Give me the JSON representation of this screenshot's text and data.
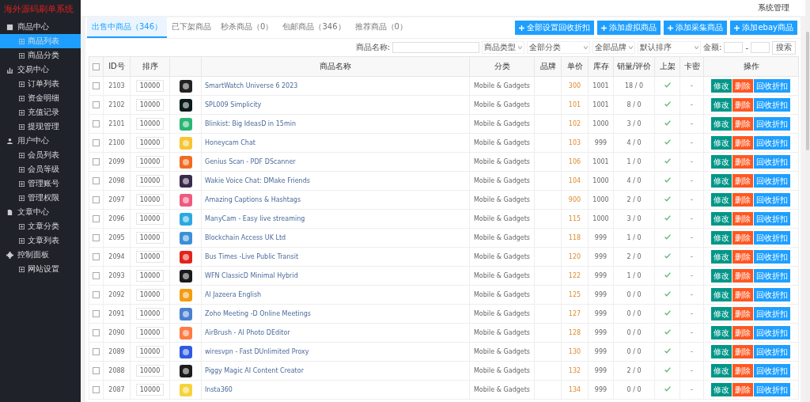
{
  "sidebar": {
    "title": "海外源码刷单系统",
    "groups": [
      {
        "label": "商品中心",
        "items": [
          {
            "label": "商品列表",
            "selected": true
          },
          {
            "label": "商品分类",
            "selected": false
          }
        ]
      },
      {
        "label": "交易中心",
        "items": [
          {
            "label": "订单列表",
            "selected": false
          },
          {
            "label": "资金明细",
            "selected": false
          },
          {
            "label": "充值记录",
            "selected": false
          },
          {
            "label": "提现管理",
            "selected": false
          }
        ]
      },
      {
        "label": "用户中心",
        "items": [
          {
            "label": "会员列表",
            "selected": false
          },
          {
            "label": "会员等级",
            "selected": false
          },
          {
            "label": "管理账号",
            "selected": false
          },
          {
            "label": "管理权限",
            "selected": false
          }
        ]
      },
      {
        "label": "文章中心",
        "items": [
          {
            "label": "文章分类",
            "selected": false
          },
          {
            "label": "文章列表",
            "selected": false
          }
        ]
      },
      {
        "label": "控制面板",
        "items": [
          {
            "label": "网站设置",
            "selected": false
          }
        ]
      }
    ]
  },
  "topbar": {
    "user_menu": "系统管理"
  },
  "tabs": [
    {
      "label": "出售中商品（346）",
      "selected": true
    },
    {
      "label": "已下架商品",
      "selected": false
    },
    {
      "label": "秒杀商品（0）",
      "selected": false
    },
    {
      "label": "包邮商品（346）",
      "selected": false
    },
    {
      "label": "推荐商品（0）",
      "selected": false
    }
  ],
  "actions": [
    "全部设置回收折扣",
    "添加虚拟商品",
    "添加采集商品",
    "添加ebay商品"
  ],
  "filters": {
    "name_label": "商品名称:",
    "selects": [
      "商品类型",
      "全部分类",
      "全部品牌",
      "默认排序"
    ],
    "price_label": "金额:",
    "price_sep": "-",
    "search": "搜索"
  },
  "table": {
    "all_checked": false,
    "columns": [
      "ID号",
      "排序",
      "商品名称",
      "分类",
      "品牌",
      "单价",
      "库存",
      "销量/评价",
      "上架",
      "卡密",
      "操作"
    ],
    "rows": [
      {
        "checked": false,
        "id": "2103",
        "sort": "10000",
        "name": "SmartWatch Universe 6 2023",
        "category": "Mobile & Gadgets",
        "price": "300",
        "stock": "1001",
        "sales": "18 / 0",
        "listed": true,
        "card": "-",
        "color": "#222222",
        "buttons": [
          "修改",
          "删除",
          "回收折扣"
        ]
      },
      {
        "checked": false,
        "id": "2102",
        "sort": "10000",
        "name": "SPL009 Simplicity",
        "category": "Mobile & Gadgets",
        "price": "101",
        "stock": "1001",
        "sales": "8 / 0",
        "listed": true,
        "card": "-",
        "color": "#0b1a1a",
        "buttons": [
          "修改",
          "删除",
          "回收折扣"
        ]
      },
      {
        "checked": false,
        "id": "2101",
        "sort": "10000",
        "name": "Blinkist: Big IdeasD in 15min",
        "category": "Mobile & Gadgets",
        "price": "102",
        "stock": "1000",
        "sales": "3 / 0",
        "listed": true,
        "card": "-",
        "color": "#2bb673",
        "buttons": [
          "修改",
          "删除",
          "回收折扣"
        ]
      },
      {
        "checked": false,
        "id": "2100",
        "sort": "10000",
        "name": "Honeycam Chat",
        "category": "Mobile & Gadgets",
        "price": "103",
        "stock": "999",
        "sales": "4 / 0",
        "listed": true,
        "card": "-",
        "color": "#f7c531",
        "buttons": [
          "修改",
          "删除",
          "回收折扣"
        ]
      },
      {
        "checked": false,
        "id": "2099",
        "sort": "10000",
        "name": "Genius Scan - PDF DScanner",
        "category": "Mobile & Gadgets",
        "price": "106",
        "stock": "1001",
        "sales": "1 / 0",
        "listed": true,
        "card": "-",
        "color": "#f26b21",
        "buttons": [
          "修改",
          "删除",
          "回收折扣"
        ]
      },
      {
        "checked": false,
        "id": "2098",
        "sort": "10000",
        "name": "Wakie Voice Chat: DMake Friends",
        "category": "Mobile & Gadgets",
        "price": "104",
        "stock": "1000",
        "sales": "4 / 0",
        "listed": true,
        "card": "-",
        "color": "#3a2a4a",
        "buttons": [
          "修改",
          "删除",
          "回收折扣"
        ]
      },
      {
        "checked": false,
        "id": "2097",
        "sort": "10000",
        "name": "Amazing Captions & Hashtags",
        "category": "Mobile & Gadgets",
        "price": "900",
        "stock": "1000",
        "sales": "2 / 0",
        "listed": true,
        "card": "-",
        "color": "#ef5a7d",
        "buttons": [
          "修改",
          "删除",
          "回收折扣"
        ]
      },
      {
        "checked": false,
        "id": "2096",
        "sort": "10000",
        "name": "ManyCam - Easy live streaming",
        "category": "Mobile & Gadgets",
        "price": "115",
        "stock": "1000",
        "sales": "3 / 0",
        "listed": true,
        "card": "-",
        "color": "#2aa9e0",
        "buttons": [
          "修改",
          "删除",
          "回收折扣"
        ]
      },
      {
        "checked": false,
        "id": "2095",
        "sort": "10000",
        "name": "Blockchain Access UK Ltd",
        "category": "Mobile & Gadgets",
        "price": "118",
        "stock": "999",
        "sales": "1 / 0",
        "listed": true,
        "card": "-",
        "color": "#3b8fd9",
        "buttons": [
          "修改",
          "删除",
          "回收折扣"
        ]
      },
      {
        "checked": false,
        "id": "2094",
        "sort": "10000",
        "name": "Bus Times -Live Public Transit",
        "category": "Mobile & Gadgets",
        "price": "120",
        "stock": "999",
        "sales": "2 / 0",
        "listed": true,
        "card": "-",
        "color": "#e2231a",
        "buttons": [
          "修改",
          "删除",
          "回收折扣"
        ]
      },
      {
        "checked": false,
        "id": "2093",
        "sort": "10000",
        "name": "WFN ClassicD Minimal Hybrid",
        "category": "Mobile & Gadgets",
        "price": "122",
        "stock": "999",
        "sales": "1 / 0",
        "listed": true,
        "card": "-",
        "color": "#1a1a1a",
        "buttons": [
          "修改",
          "删除",
          "回收折扣"
        ]
      },
      {
        "checked": false,
        "id": "2092",
        "sort": "10000",
        "name": "Al Jazeera English",
        "category": "Mobile & Gadgets",
        "price": "125",
        "stock": "999",
        "sales": "0 / 0",
        "listed": true,
        "card": "-",
        "color": "#f39c12",
        "buttons": [
          "修改",
          "删除",
          "回收折扣"
        ]
      },
      {
        "checked": false,
        "id": "2091",
        "sort": "10000",
        "name": "Zoho Meeting -D Online Meetings",
        "category": "Mobile & Gadgets",
        "price": "127",
        "stock": "999",
        "sales": "0 / 0",
        "listed": true,
        "card": "-",
        "color": "#4a7fd0",
        "buttons": [
          "修改",
          "删除",
          "回收折扣"
        ]
      },
      {
        "checked": false,
        "id": "2090",
        "sort": "10000",
        "name": "AirBrush - AI Photo DEditor",
        "category": "Mobile & Gadgets",
        "price": "128",
        "stock": "999",
        "sales": "0 / 0",
        "listed": true,
        "card": "-",
        "color": "#ff7a45",
        "buttons": [
          "修改",
          "删除",
          "回收折扣"
        ]
      },
      {
        "checked": false,
        "id": "2089",
        "sort": "10000",
        "name": "wiresvpn - Fast DUnlimited Proxy",
        "category": "Mobile & Gadgets",
        "price": "130",
        "stock": "999",
        "sales": "0 / 0",
        "listed": true,
        "card": "-",
        "color": "#2f5be0",
        "buttons": [
          "修改",
          "删除",
          "回收折扣"
        ]
      },
      {
        "checked": false,
        "id": "2088",
        "sort": "10000",
        "name": "Piggy Magic AI Content Creator",
        "category": "Mobile & Gadgets",
        "price": "132",
        "stock": "999",
        "sales": "2 / 0",
        "listed": true,
        "card": "-",
        "color": "#1c1c1c",
        "buttons": [
          "修改",
          "删除",
          "回收折扣"
        ]
      },
      {
        "checked": false,
        "id": "2087",
        "sort": "10000",
        "name": "Insta360",
        "category": "Mobile & Gadgets",
        "price": "134",
        "stock": "999",
        "sales": "0 / 0",
        "listed": true,
        "card": "-",
        "color": "#f5d33b",
        "buttons": [
          "修改",
          "删除",
          "回收折扣"
        ]
      }
    ]
  }
}
